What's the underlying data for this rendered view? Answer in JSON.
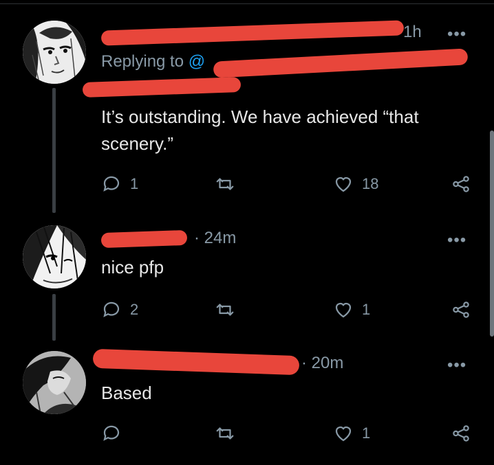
{
  "tweets": [
    {
      "time": "1h",
      "more": "•••",
      "replying_prefix": "Replying to",
      "replying_handle": "@",
      "text": "It’s outstanding. We have achieved “that scenery.”",
      "reply_count": "1",
      "retweet_count": "",
      "like_count": "18"
    },
    {
      "time": "· 24m",
      "more": "•••",
      "text": "nice pfp",
      "reply_count": "2",
      "retweet_count": "",
      "like_count": "1"
    },
    {
      "time": "· 20m",
      "more": "•••",
      "text": "Based",
      "reply_count": "",
      "retweet_count": "",
      "like_count": "1"
    }
  ],
  "icons": {
    "reply": "comment-bubble-icon",
    "retweet": "retweet-arrows-icon",
    "like": "heart-outline-icon",
    "share": "share-nodes-icon",
    "more": "more-dots-icon"
  },
  "colors": {
    "background": "#000000",
    "secondary_text": "#8899a6",
    "link": "#1da1f2",
    "redaction": "#e8463b",
    "thread_line": "#3a3f44"
  }
}
